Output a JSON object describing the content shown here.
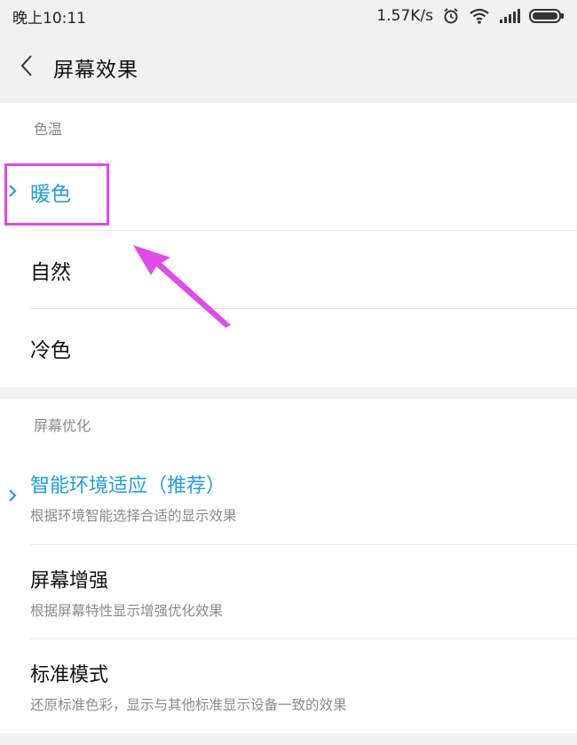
{
  "status_bar": {
    "time": "晚上10:11",
    "network_speed": "1.57K/s",
    "icons": [
      "alarm-icon",
      "wifi-icon",
      "signal-icon",
      "battery-icon"
    ]
  },
  "header": {
    "title": "屏幕效果"
  },
  "color_temperature": {
    "section_label": "色温",
    "options": [
      {
        "label": "暖色",
        "selected": true
      },
      {
        "label": "自然",
        "selected": false
      },
      {
        "label": "冷色",
        "selected": false
      }
    ]
  },
  "screen_optimization": {
    "section_label": "屏幕优化",
    "options": [
      {
        "label": "智能环境适应（推荐）",
        "desc": "根据环境智能选择合适的显示效果",
        "selected": true
      },
      {
        "label": "屏幕增强",
        "desc": "根据屏幕特性显示增强优化效果",
        "selected": false
      },
      {
        "label": "标准模式",
        "desc": "还原标准色彩，显示与其他标准显示设备一致的效果",
        "selected": false
      }
    ]
  },
  "colors": {
    "accent": "#1e9fe0",
    "annotation": "#e14be6",
    "background": "#f1f1f1"
  }
}
